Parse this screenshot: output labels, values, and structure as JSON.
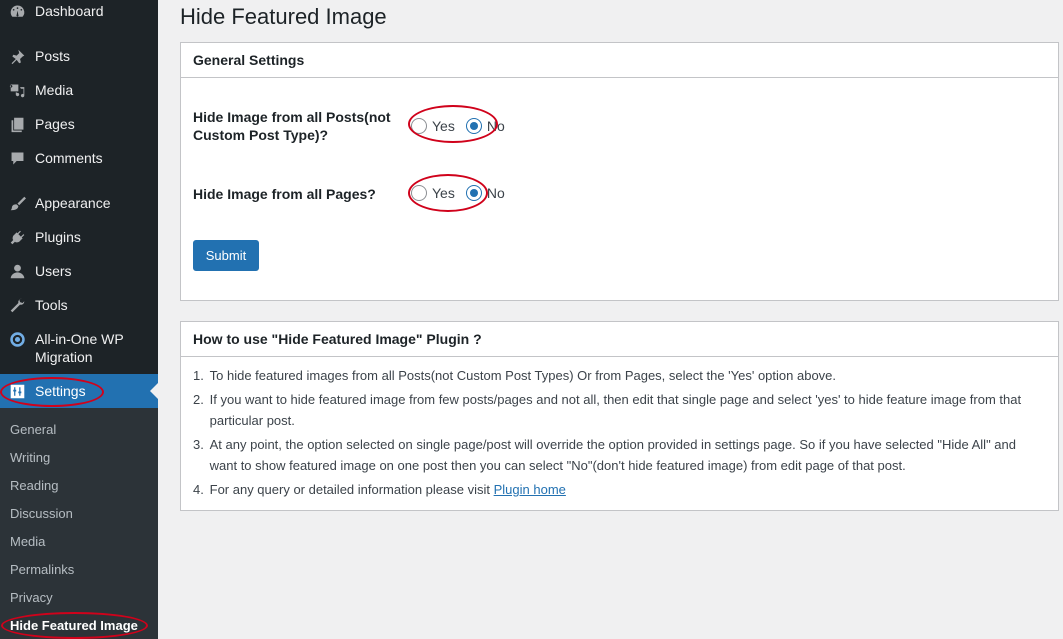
{
  "sidebar": {
    "items": [
      {
        "id": "dashboard",
        "label": "Dashboard",
        "icon": "dashboard-icon"
      },
      {
        "id": "posts",
        "label": "Posts",
        "icon": "pin-icon"
      },
      {
        "id": "media",
        "label": "Media",
        "icon": "media-icon"
      },
      {
        "id": "pages",
        "label": "Pages",
        "icon": "pages-icon"
      },
      {
        "id": "comments",
        "label": "Comments",
        "icon": "comment-icon"
      },
      {
        "id": "appearance",
        "label": "Appearance",
        "icon": "paintbrush-icon"
      },
      {
        "id": "plugins",
        "label": "Plugins",
        "icon": "plug-icon"
      },
      {
        "id": "users",
        "label": "Users",
        "icon": "user-icon"
      },
      {
        "id": "tools",
        "label": "Tools",
        "icon": "wrench-icon"
      },
      {
        "id": "migration",
        "label": "All-in-One WP Migration",
        "label_line1": "All-in-One WP",
        "label_line2": "Migration",
        "icon": "migration-icon"
      },
      {
        "id": "settings",
        "label": "Settings",
        "icon": "settings-sliders-icon",
        "active": true
      }
    ],
    "submenu": [
      {
        "label": "General"
      },
      {
        "label": "Writing"
      },
      {
        "label": "Reading"
      },
      {
        "label": "Discussion"
      },
      {
        "label": "Media"
      },
      {
        "label": "Permalinks"
      },
      {
        "label": "Privacy"
      },
      {
        "label": "Hide Featured Image",
        "current": true
      }
    ]
  },
  "page": {
    "title": "Hide Featured Image"
  },
  "general_settings": {
    "heading": "General Settings",
    "fields": [
      {
        "label": "Hide Image from all Posts(not Custom Post Type)?",
        "options": [
          "Yes",
          "No"
        ],
        "selected": "No"
      },
      {
        "label": "Hide Image from all Pages?",
        "options": [
          "Yes",
          "No"
        ],
        "selected": "No"
      }
    ],
    "submit_label": "Submit"
  },
  "howto": {
    "heading": "How to use \"Hide Featured Image\" Plugin ?",
    "items": [
      {
        "num": "1.",
        "text": "To hide featured images from all Posts(not Custom Post Types) Or from Pages, select the 'Yes' option above."
      },
      {
        "num": "2.",
        "text": "If you want to hide featured image from few posts/pages and not all, then edit that single page and select 'yes' to hide feature image from that particular post."
      },
      {
        "num": "3.",
        "text": "At any point, the option selected on single page/post will override the option provided in settings page. So if you have selected \"Hide All\" and want to show featured image on one post then you can select \"No\"(don't hide featured image) from edit page of that post."
      },
      {
        "num": "4.",
        "text": "For any query or detailed information please visit ",
        "link_text": "Plugin home"
      }
    ]
  },
  "colors": {
    "sidebar_bg": "#1d2327",
    "accent": "#2271b1",
    "annotation": "#d0021b"
  }
}
